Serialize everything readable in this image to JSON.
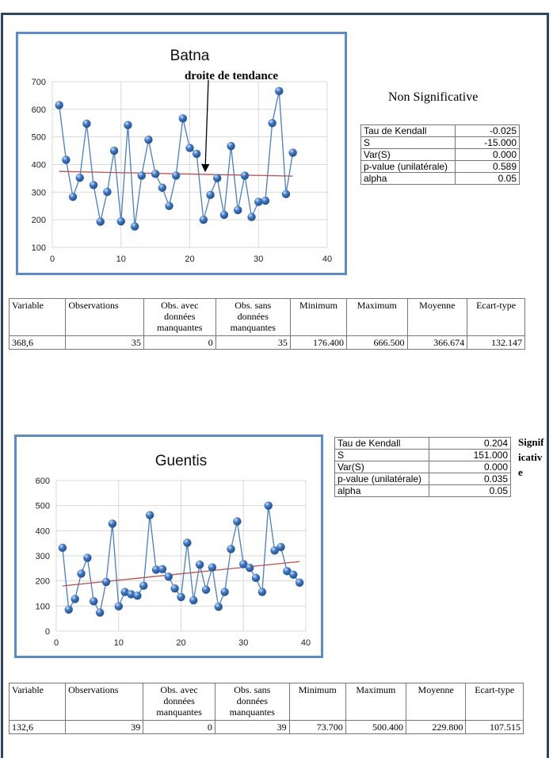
{
  "chart_data": [
    {
      "type": "line",
      "title": "Batna",
      "annotation": "droite de tendance",
      "xlabel": "",
      "ylabel": "",
      "xlim": [
        0,
        40
      ],
      "ylim": [
        100,
        700
      ],
      "xticks": [
        0,
        10,
        20,
        30,
        40
      ],
      "yticks": [
        100,
        200,
        300,
        400,
        500,
        600,
        700
      ],
      "grid": true,
      "legend": "none",
      "x": [
        1,
        2,
        3,
        4,
        5,
        6,
        7,
        8,
        9,
        10,
        11,
        12,
        13,
        14,
        15,
        16,
        17,
        18,
        19,
        20,
        21,
        22,
        23,
        24,
        25,
        26,
        27,
        28,
        29,
        30,
        31,
        32,
        33,
        34,
        35
      ],
      "series": [
        {
          "name": "Batna",
          "values": [
            615,
            417,
            283,
            352,
            548,
            326,
            193,
            301,
            450,
            194,
            543,
            176,
            360,
            490,
            366,
            316,
            250,
            360,
            567,
            460,
            439,
            200,
            290,
            351,
            218,
            467,
            235,
            360,
            210,
            265,
            269,
            550,
            666,
            293,
            443
          ]
        }
      ],
      "trendline": {
        "x": [
          1,
          35
        ],
        "y": [
          375,
          358
        ]
      }
    },
    {
      "type": "line",
      "title": "Guentis",
      "xlabel": "",
      "ylabel": "",
      "xlim": [
        0,
        40
      ],
      "ylim": [
        0,
        600
      ],
      "xticks": [
        0,
        10,
        20,
        30,
        40
      ],
      "yticks": [
        0,
        100,
        200,
        300,
        400,
        500,
        600
      ],
      "grid": true,
      "legend": "none",
      "x": [
        1,
        2,
        3,
        4,
        5,
        6,
        7,
        8,
        9,
        10,
        11,
        12,
        13,
        14,
        15,
        16,
        17,
        18,
        19,
        20,
        21,
        22,
        23,
        24,
        25,
        26,
        27,
        28,
        29,
        30,
        31,
        32,
        33,
        34,
        35,
        36,
        37,
        38,
        39
      ],
      "series": [
        {
          "name": "Guentis",
          "values": [
            332,
            86,
            128,
            229,
            292,
            119,
            74,
            196,
            428,
            99,
            156,
            147,
            141,
            181,
            462,
            245,
            247,
            217,
            170,
            136,
            352,
            123,
            265,
            165,
            254,
            97,
            156,
            327,
            437,
            267,
            252,
            212,
            156,
            500,
            321,
            335,
            239,
            225,
            193
          ]
        }
      ],
      "trendline": {
        "x": [
          1,
          39
        ],
        "y": [
          180,
          277
        ]
      }
    }
  ],
  "colors": {
    "series": "#4a7ec2",
    "marker": "#3d78c8",
    "trend": "#c0504d",
    "chart_border": "#5b8bc9",
    "page_border": "#2e4566",
    "grid": "#d9d9d9"
  },
  "batna": {
    "verdict": "Non Significative",
    "kendall": [
      {
        "label": "Tau de Kendall",
        "value": "-0.025"
      },
      {
        "label": "S",
        "value": "-15.000"
      },
      {
        "label": "Var(S)",
        "value": "0.000"
      },
      {
        "label": "p-value (unilatérale)",
        "value": "0.589"
      },
      {
        "label": "alpha",
        "value": "0.05"
      }
    ],
    "desc": {
      "headers": [
        "Variable",
        "Observations",
        "Obs. avec données manquantes",
        "Obs. sans données manquantes",
        "Minimum",
        "Maximum",
        "Moyenne",
        "Ecart-type"
      ],
      "row": [
        "368,6",
        "35",
        "0",
        "35",
        "176.400",
        "666.500",
        "366.674",
        "132.147"
      ]
    }
  },
  "guentis": {
    "verdict_lines": [
      "Signif",
      "icativ",
      "e"
    ],
    "kendall": [
      {
        "label": "Tau de Kendall",
        "value": "0.204"
      },
      {
        "label": "S",
        "value": "151.000"
      },
      {
        "label": "Var(S)",
        "value": "0.000"
      },
      {
        "label": "p-value (unilatérale)",
        "value": "0.035"
      },
      {
        "label": "alpha",
        "value": "0.05"
      }
    ],
    "desc": {
      "headers": [
        "Variable",
        "Observations",
        "Obs. avec données manquantes",
        "Obs. sans données manquantes",
        "Minimum",
        "Maximum",
        "Moyenne",
        "Ecart-type"
      ],
      "row": [
        "132,6",
        "39",
        "0",
        "39",
        "73.700",
        "500.400",
        "229.800",
        "107.515"
      ]
    }
  }
}
